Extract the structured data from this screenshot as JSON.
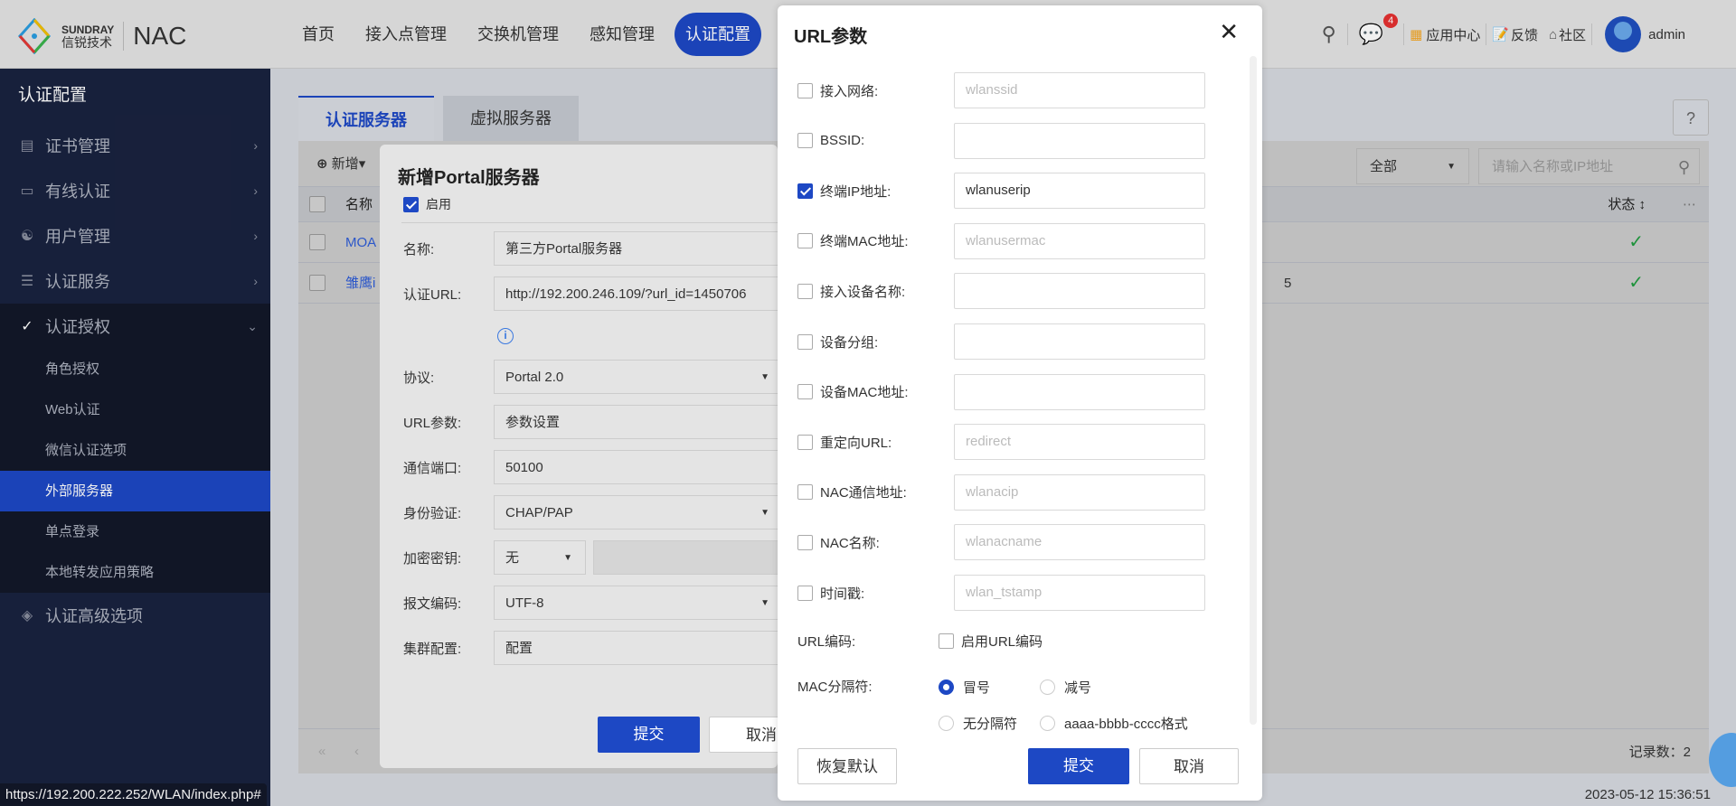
{
  "header": {
    "brand_en": "SUNDRAY",
    "brand_cn": "信锐技术",
    "product": "NAC",
    "nav": [
      {
        "label": "首页",
        "active": false
      },
      {
        "label": "接入点管理",
        "active": false
      },
      {
        "label": "交换机管理",
        "active": false
      },
      {
        "label": "感知管理",
        "active": false
      },
      {
        "label": "认证配置",
        "active": true
      }
    ],
    "message_badge": "4",
    "app_center": "应用中心",
    "feedback": "反馈",
    "community": "社区",
    "user": "admin"
  },
  "sidebar": {
    "title": "认证配置",
    "items": [
      {
        "label": "证书管理",
        "icon": "certificate-icon"
      },
      {
        "label": "有线认证",
        "icon": "wired-icon"
      },
      {
        "label": "用户管理",
        "icon": "user-icon"
      },
      {
        "label": "认证服务",
        "icon": "user-list-icon"
      },
      {
        "label": "认证授权",
        "icon": "user-check-icon"
      }
    ],
    "subitems": [
      {
        "label": "角色授权",
        "active": false
      },
      {
        "label": "Web认证",
        "active": false
      },
      {
        "label": "微信认证选项",
        "active": false
      },
      {
        "label": "外部服务器",
        "active": true
      },
      {
        "label": "单点登录",
        "active": false
      },
      {
        "label": "本地转发应用策略",
        "active": false
      }
    ],
    "advanced": {
      "label": "认证高级选项",
      "icon": "diamond-icon"
    }
  },
  "status_url": "https://192.200.222.252/WLAN/index.php#",
  "main": {
    "tabs": [
      {
        "label": "认证服务器",
        "active": true
      },
      {
        "label": "虚拟服务器",
        "active": false
      }
    ],
    "add_label": "新增",
    "filter_value": "全部",
    "search_placeholder": "请输入名称或IP地址",
    "columns": {
      "name": "名称",
      "status": "状态"
    },
    "rows": [
      {
        "name": "MOA",
        "tail": ""
      },
      {
        "name": "雏鹰i",
        "tail": "5"
      }
    ],
    "record_count": "记录数：2",
    "datetime": "2023-05-12 15:36:51"
  },
  "portal_dialog": {
    "title": "新增Portal服务器",
    "enable_label": "启用",
    "enable_checked": true,
    "fields": {
      "name": {
        "label": "名称:",
        "value": "第三方Portal服务器"
      },
      "auth_url": {
        "label": "认证URL:",
        "value": "http://192.200.246.109/?url_id=1450706"
      },
      "protocol": {
        "label": "协议:",
        "value": "Portal 2.0"
      },
      "url_params": {
        "label": "URL参数:",
        "value": "参数设置"
      },
      "port": {
        "label": "通信端口:",
        "value": "50100"
      },
      "auth": {
        "label": "身份验证:",
        "value": "CHAP/PAP"
      },
      "encrypt": {
        "label": "加密密钥:",
        "value": "无"
      },
      "encoding": {
        "label": "报文编码:",
        "value": "UTF-8"
      },
      "cluster": {
        "label": "集群配置:",
        "value": "配置"
      }
    },
    "submit": "提交",
    "cancel": "取消"
  },
  "url_dialog": {
    "title": "URL参数",
    "params": [
      {
        "label": "接入网络:",
        "checked": false,
        "value": "",
        "placeholder": "wlanssid"
      },
      {
        "label": "BSSID:",
        "checked": false,
        "value": "",
        "placeholder": ""
      },
      {
        "label": "终端IP地址:",
        "checked": true,
        "value": "wlanuserip",
        "placeholder": ""
      },
      {
        "label": "终端MAC地址:",
        "checked": false,
        "value": "",
        "placeholder": "wlanusermac"
      },
      {
        "label": "接入设备名称:",
        "checked": false,
        "value": "",
        "placeholder": ""
      },
      {
        "label": "设备分组:",
        "checked": false,
        "value": "",
        "placeholder": ""
      },
      {
        "label": "设备MAC地址:",
        "checked": false,
        "value": "",
        "placeholder": ""
      },
      {
        "label": "重定向URL:",
        "checked": false,
        "value": "",
        "placeholder": "redirect"
      },
      {
        "label": "NAC通信地址:",
        "checked": false,
        "value": "",
        "placeholder": "wlanacip"
      },
      {
        "label": "NAC名称:",
        "checked": false,
        "value": "",
        "placeholder": "wlanacname"
      },
      {
        "label": "时间戳:",
        "checked": false,
        "value": "",
        "placeholder": "wlan_tstamp"
      }
    ],
    "url_encode_label": "URL编码:",
    "url_encode_option": "启用URL编码",
    "url_encode_checked": false,
    "mac_sep_label": "MAC分隔符:",
    "mac_sep_options": [
      {
        "label": "冒号",
        "checked": true
      },
      {
        "label": "减号",
        "checked": false
      },
      {
        "label": "无分隔符",
        "checked": false
      },
      {
        "label": "aaaa-bbbb-cccc格式",
        "checked": false
      }
    ],
    "restore": "恢复默认",
    "submit": "提交",
    "cancel": "取消"
  }
}
